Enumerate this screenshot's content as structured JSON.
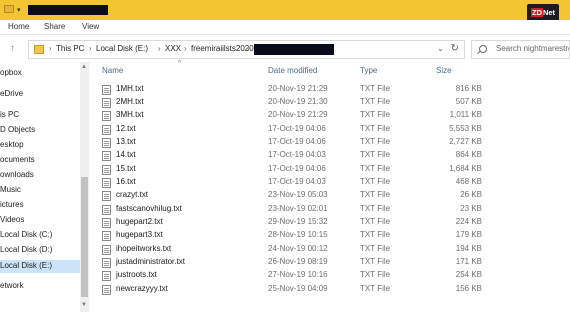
{
  "ribbon": {
    "tabs": [
      "Home",
      "Share",
      "View"
    ]
  },
  "watermark": {
    "brand": "ZDNet",
    "brand_accent": "ZD",
    "brand_rest": "Net",
    "accent_color": "#d21f26"
  },
  "address": {
    "breadcrumbs": [
      "This PC",
      "Local Disk (E:)",
      "XXX",
      "freemiraiilsts2020"
    ],
    "search_placeholder": "Search nightmarestre"
  },
  "nav": {
    "items": [
      "opbox",
      "eDrive",
      "is PC",
      "D Objects",
      "esktop",
      "ocuments",
      "ownloads",
      "Music",
      "ictures",
      "Videos",
      "Local Disk (C:)",
      "Local Disk (D:)",
      "Local Disk (E:)",
      "etwork"
    ],
    "selected_index": 12
  },
  "columns": {
    "name": "Name",
    "date": "Date modified",
    "type": "Type",
    "size": "Size"
  },
  "files": [
    {
      "name": "1MH.txt",
      "date": "20-Nov-19 21:29",
      "type": "TXT File",
      "size": "816 KB"
    },
    {
      "name": "2MH.txt",
      "date": "20-Nov-19 21:30",
      "type": "TXT File",
      "size": "507 KB"
    },
    {
      "name": "3MH.txt",
      "date": "20-Nov-19 21:29",
      "type": "TXT File",
      "size": "1,011 KB"
    },
    {
      "name": "12.txt",
      "date": "17-Oct-19 04:06",
      "type": "TXT File",
      "size": "5,553 KB"
    },
    {
      "name": "13.txt",
      "date": "17-Oct-19 04:06",
      "type": "TXT File",
      "size": "2,727 KB"
    },
    {
      "name": "14.txt",
      "date": "17-Oct-19 04:03",
      "type": "TXT File",
      "size": "864 KB"
    },
    {
      "name": "15.txt",
      "date": "17-Oct-19 04:06",
      "type": "TXT File",
      "size": "1,684 KB"
    },
    {
      "name": "16.txt",
      "date": "17-Oct-19 04:03",
      "type": "TXT File",
      "size": "468 KB"
    },
    {
      "name": "crazyt.txt",
      "date": "23-Nov-19 05:03",
      "type": "TXT File",
      "size": "26 KB"
    },
    {
      "name": "fastscanovhilug.txt",
      "date": "23-Nov-19 02:01",
      "type": "TXT File",
      "size": "23 KB"
    },
    {
      "name": "hugepart2.txt",
      "date": "29-Nov-19 15:32",
      "type": "TXT File",
      "size": "224 KB"
    },
    {
      "name": "hugepart3.txt",
      "date": "28-Nov-19 10:15",
      "type": "TXT File",
      "size": "179 KB"
    },
    {
      "name": "ihopeitworks.txt",
      "date": "24-Nov-19 00:12",
      "type": "TXT File",
      "size": "194 KB"
    },
    {
      "name": "justadministrator.txt",
      "date": "26-Nov-19 08:19",
      "type": "TXT File",
      "size": "171 KB"
    },
    {
      "name": "justroots.txt",
      "date": "27-Nov-19 10:16",
      "type": "TXT File",
      "size": "254 KB"
    },
    {
      "name": "newcrazyyy.txt",
      "date": "25-Nov-19 04:09",
      "type": "TXT File",
      "size": "156 KB"
    }
  ]
}
